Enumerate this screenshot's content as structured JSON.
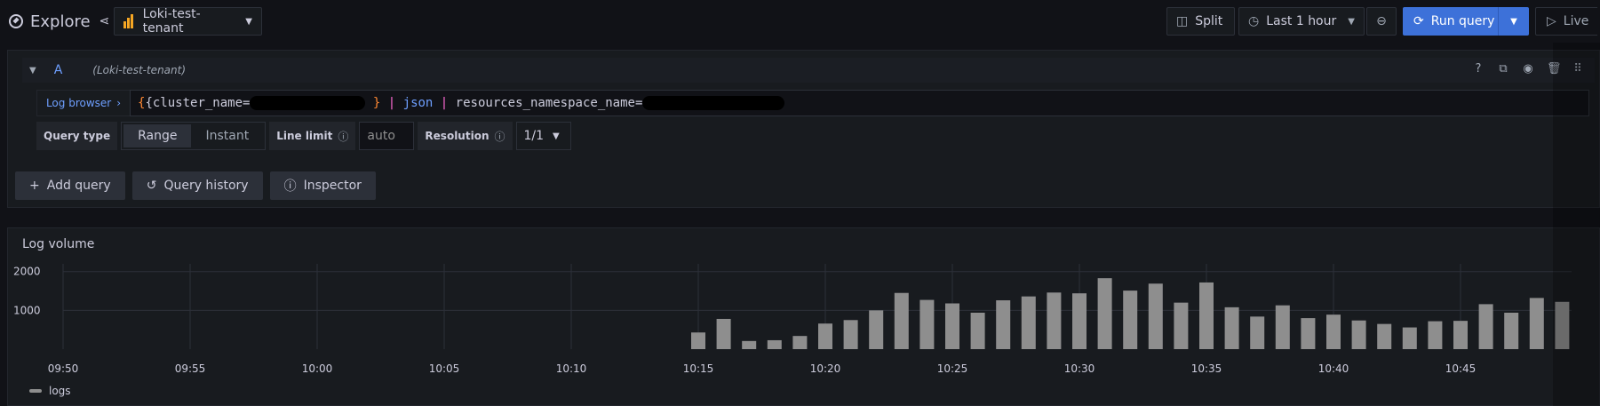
{
  "header": {
    "title": "Explore",
    "datasource": "Loki-test-tenant",
    "split_label": "Split",
    "time_range_label": "Last 1 hour",
    "run_query_label": "Run query",
    "live_label": "Live"
  },
  "query": {
    "ref_id": "A",
    "datasource_label": "(Loki-test-tenant)",
    "log_browser_label": "Log browser",
    "expr_open": "{cluster_name=",
    "expr_close": "}",
    "pipe": "|",
    "fn_json": "json",
    "label2": "resources_namespace_name="
  },
  "options": {
    "query_type_label": "Query type",
    "query_type_options": [
      "Range",
      "Instant"
    ],
    "query_type_selected": "Range",
    "line_limit_label": "Line limit",
    "line_limit_placeholder": "auto",
    "resolution_label": "Resolution",
    "resolution_value": "1/1"
  },
  "actions": {
    "add_query": "Add query",
    "query_history": "Query history",
    "inspector": "Inspector"
  },
  "volume": {
    "title": "Log volume",
    "legend": "logs"
  },
  "colors": {
    "accent": "#3d71d9",
    "bar": "#8e8e8e",
    "link": "#6e9fff"
  },
  "chart_data": {
    "type": "bar",
    "ylim": [
      0,
      2200
    ],
    "yticks": [
      1000,
      2000
    ],
    "yticklabels": [
      "1000",
      "2000"
    ],
    "xticklabels": [
      "09:50",
      "09:55",
      "10:00",
      "10:05",
      "10:10",
      "10:15",
      "10:20",
      "10:25",
      "10:30",
      "10:35",
      "10:40",
      "10:45"
    ],
    "series": [
      {
        "name": "logs",
        "x": [
          "10:15",
          "10:16",
          "10:17",
          "10:18",
          "10:19",
          "10:20",
          "10:21",
          "10:22",
          "10:23",
          "10:24",
          "10:25",
          "10:26",
          "10:27",
          "10:28",
          "10:29",
          "10:30",
          "10:31",
          "10:32",
          "10:33",
          "10:34",
          "10:35",
          "10:36",
          "10:37",
          "10:38",
          "10:39",
          "10:40",
          "10:41",
          "10:42",
          "10:43",
          "10:44",
          "10:45",
          "10:46",
          "10:47",
          "10:48",
          "10:49"
        ],
        "values": [
          430,
          780,
          210,
          230,
          340,
          660,
          750,
          1000,
          1450,
          1270,
          1180,
          940,
          1260,
          1360,
          1460,
          1440,
          1830,
          1510,
          1690,
          1200,
          1720,
          1080,
          840,
          1130,
          800,
          890,
          740,
          650,
          560,
          720,
          730,
          1160,
          940,
          1320,
          1220
        ]
      }
    ]
  }
}
